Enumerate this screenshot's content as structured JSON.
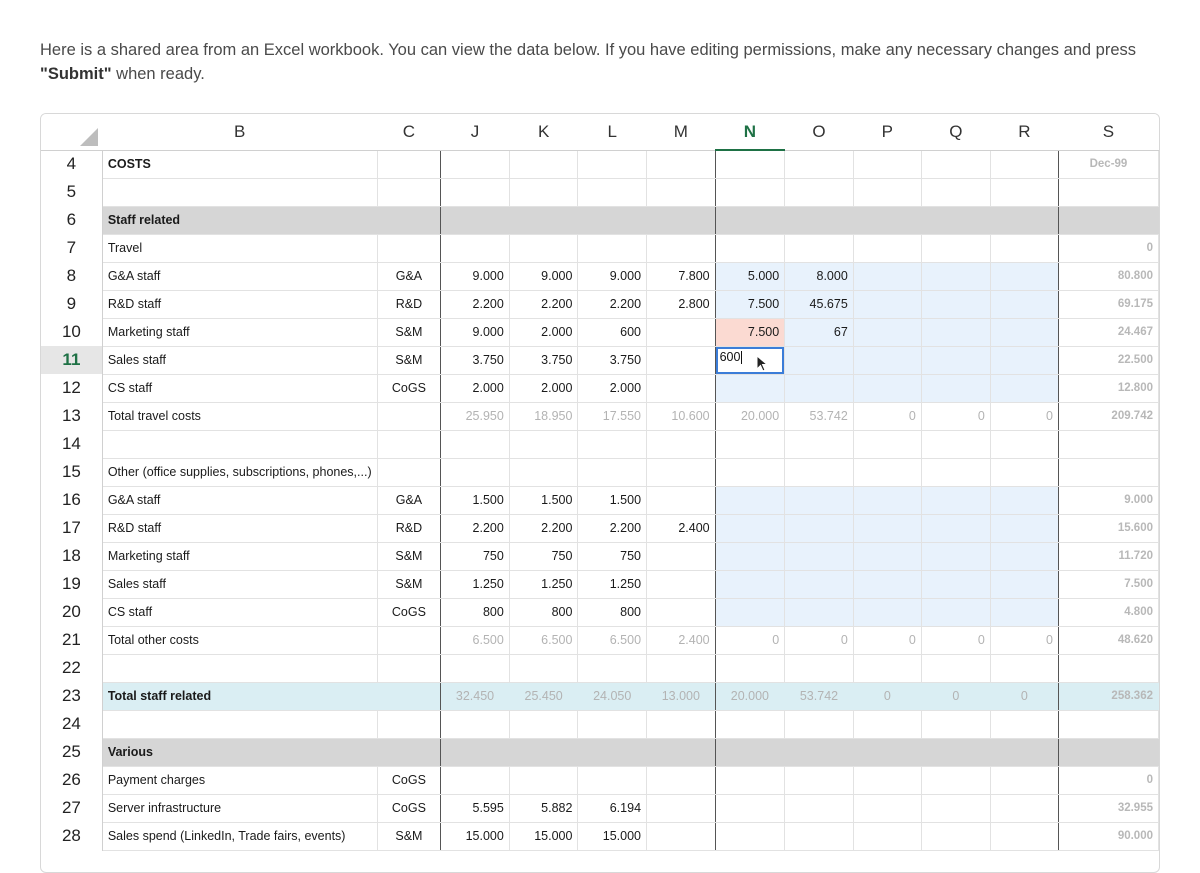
{
  "intro": {
    "text_before": "Here is a shared area from an Excel workbook. You can view the data below. If you have editing permissions, make any necessary changes and press ",
    "submit_quoted": "\"Submit\"",
    "text_after": " when ready."
  },
  "columns": [
    "B",
    "C",
    "J",
    "K",
    "L",
    "M",
    "N",
    "O",
    "P",
    "Q",
    "R",
    "S"
  ],
  "active_column": "N",
  "active_row": "11",
  "editing_cell": {
    "ref": "N11",
    "value": "600"
  },
  "colors": {
    "accent_green": "#1e7145",
    "selection_blue": "#3b7dd8",
    "editable_fill": "#e8f2fc",
    "highlight_pink": "#fbdad2",
    "section_gray": "#d6d6d6",
    "total_teal": "#daeef3"
  },
  "rows": [
    {
      "num": "4",
      "b": "COSTS",
      "c": "",
      "vals": [
        "",
        "",
        "",
        "",
        "",
        "",
        "",
        "",
        "",
        ""
      ],
      "s": "Dec-99"
    },
    {
      "num": "5",
      "b": "",
      "c": "",
      "vals": [
        "",
        "",
        "",
        "",
        "",
        "",
        "",
        "",
        "",
        ""
      ],
      "s": ""
    },
    {
      "num": "6",
      "b": "Staff related",
      "c": "",
      "vals": [
        "",
        "",
        "",
        "",
        "",
        "",
        "",
        "",
        "",
        ""
      ],
      "s": ""
    },
    {
      "num": "7",
      "b": "Travel",
      "c": "",
      "vals": [
        "",
        "",
        "",
        "",
        "",
        "",
        "",
        "",
        "",
        ""
      ],
      "s": "0"
    },
    {
      "num": "8",
      "b": "G&A staff",
      "c": "G&A",
      "vals": [
        "9.000",
        "9.000",
        "9.000",
        "7.800",
        "5.000",
        "8.000",
        "",
        "",
        "",
        ""
      ],
      "s": "80.800"
    },
    {
      "num": "9",
      "b": "R&D staff",
      "c": "R&D",
      "vals": [
        "2.200",
        "2.200",
        "2.200",
        "2.800",
        "7.500",
        "45.675",
        "",
        "",
        "",
        ""
      ],
      "s": "69.175"
    },
    {
      "num": "10",
      "b": "Marketing staff",
      "c": "S&M",
      "vals": [
        "9.000",
        "2.000",
        "600",
        "",
        "7.500",
        "67",
        "",
        "",
        "",
        ""
      ],
      "s": "24.467"
    },
    {
      "num": "11",
      "b": "Sales staff",
      "c": "S&M",
      "vals": [
        "3.750",
        "3.750",
        "3.750",
        "",
        "",
        "",
        "",
        "",
        "",
        ""
      ],
      "s": "22.500"
    },
    {
      "num": "12",
      "b": "CS staff",
      "c": "CoGS",
      "vals": [
        "2.000",
        "2.000",
        "2.000",
        "",
        "",
        "",
        "",
        "",
        "",
        ""
      ],
      "s": "12.800"
    },
    {
      "num": "13",
      "b": "Total travel costs",
      "c": "",
      "vals": [
        "25.950",
        "18.950",
        "17.550",
        "10.600",
        "20.000",
        "53.742",
        "0",
        "0",
        "0",
        ""
      ],
      "s": "209.742"
    },
    {
      "num": "14",
      "b": "",
      "c": "",
      "vals": [
        "",
        "",
        "",
        "",
        "",
        "",
        "",
        "",
        "",
        ""
      ],
      "s": ""
    },
    {
      "num": "15",
      "b": "Other (office supplies, subscriptions, phones,...)",
      "c": "",
      "vals": [
        "",
        "",
        "",
        "",
        "",
        "",
        "",
        "",
        "",
        ""
      ],
      "s": ""
    },
    {
      "num": "16",
      "b": "G&A staff",
      "c": "G&A",
      "vals": [
        "1.500",
        "1.500",
        "1.500",
        "",
        "",
        "",
        "",
        "",
        "",
        ""
      ],
      "s": "9.000"
    },
    {
      "num": "17",
      "b": "R&D staff",
      "c": "R&D",
      "vals": [
        "2.200",
        "2.200",
        "2.200",
        "2.400",
        "",
        "",
        "",
        "",
        "",
        ""
      ],
      "s": "15.600"
    },
    {
      "num": "18",
      "b": "Marketing staff",
      "c": "S&M",
      "vals": [
        "750",
        "750",
        "750",
        "",
        "",
        "",
        "",
        "",
        "",
        ""
      ],
      "s": "11.720"
    },
    {
      "num": "19",
      "b": "Sales staff",
      "c": "S&M",
      "vals": [
        "1.250",
        "1.250",
        "1.250",
        "",
        "",
        "",
        "",
        "",
        "",
        ""
      ],
      "s": "7.500"
    },
    {
      "num": "20",
      "b": "CS staff",
      "c": "CoGS",
      "vals": [
        "800",
        "800",
        "800",
        "",
        "",
        "",
        "",
        "",
        "",
        ""
      ],
      "s": "4.800"
    },
    {
      "num": "21",
      "b": "Total other costs",
      "c": "",
      "vals": [
        "6.500",
        "6.500",
        "6.500",
        "2.400",
        "0",
        "0",
        "0",
        "0",
        "0",
        ""
      ],
      "s": "48.620"
    },
    {
      "num": "22",
      "b": "",
      "c": "",
      "vals": [
        "",
        "",
        "",
        "",
        "",
        "",
        "",
        "",
        "",
        ""
      ],
      "s": ""
    },
    {
      "num": "23",
      "b": "Total staff related",
      "c": "",
      "vals": [
        "32.450",
        "25.450",
        "24.050",
        "13.000",
        "20.000",
        "53.742",
        "0",
        "0",
        "0",
        ""
      ],
      "s": "258.362"
    },
    {
      "num": "24",
      "b": "",
      "c": "",
      "vals": [
        "",
        "",
        "",
        "",
        "",
        "",
        "",
        "",
        "",
        ""
      ],
      "s": ""
    },
    {
      "num": "25",
      "b": "Various",
      "c": "",
      "vals": [
        "",
        "",
        "",
        "",
        "",
        "",
        "",
        "",
        "",
        ""
      ],
      "s": ""
    },
    {
      "num": "26",
      "b": "Payment charges",
      "c": "CoGS",
      "vals": [
        "",
        "",
        "",
        "",
        "",
        "",
        "",
        "",
        "",
        ""
      ],
      "s": "0"
    },
    {
      "num": "27",
      "b": "Server infrastructure",
      "c": "CoGS",
      "vals": [
        "5.595",
        "5.882",
        "6.194",
        "",
        "",
        "",
        "",
        "",
        "",
        ""
      ],
      "s": "32.955"
    },
    {
      "num": "28",
      "b": "Sales spend (LinkedIn, Trade fairs, events)",
      "c": "S&M",
      "vals": [
        "15.000",
        "15.000",
        "15.000",
        "",
        "",
        "",
        "",
        "",
        "",
        ""
      ],
      "s": "90.000"
    }
  ]
}
